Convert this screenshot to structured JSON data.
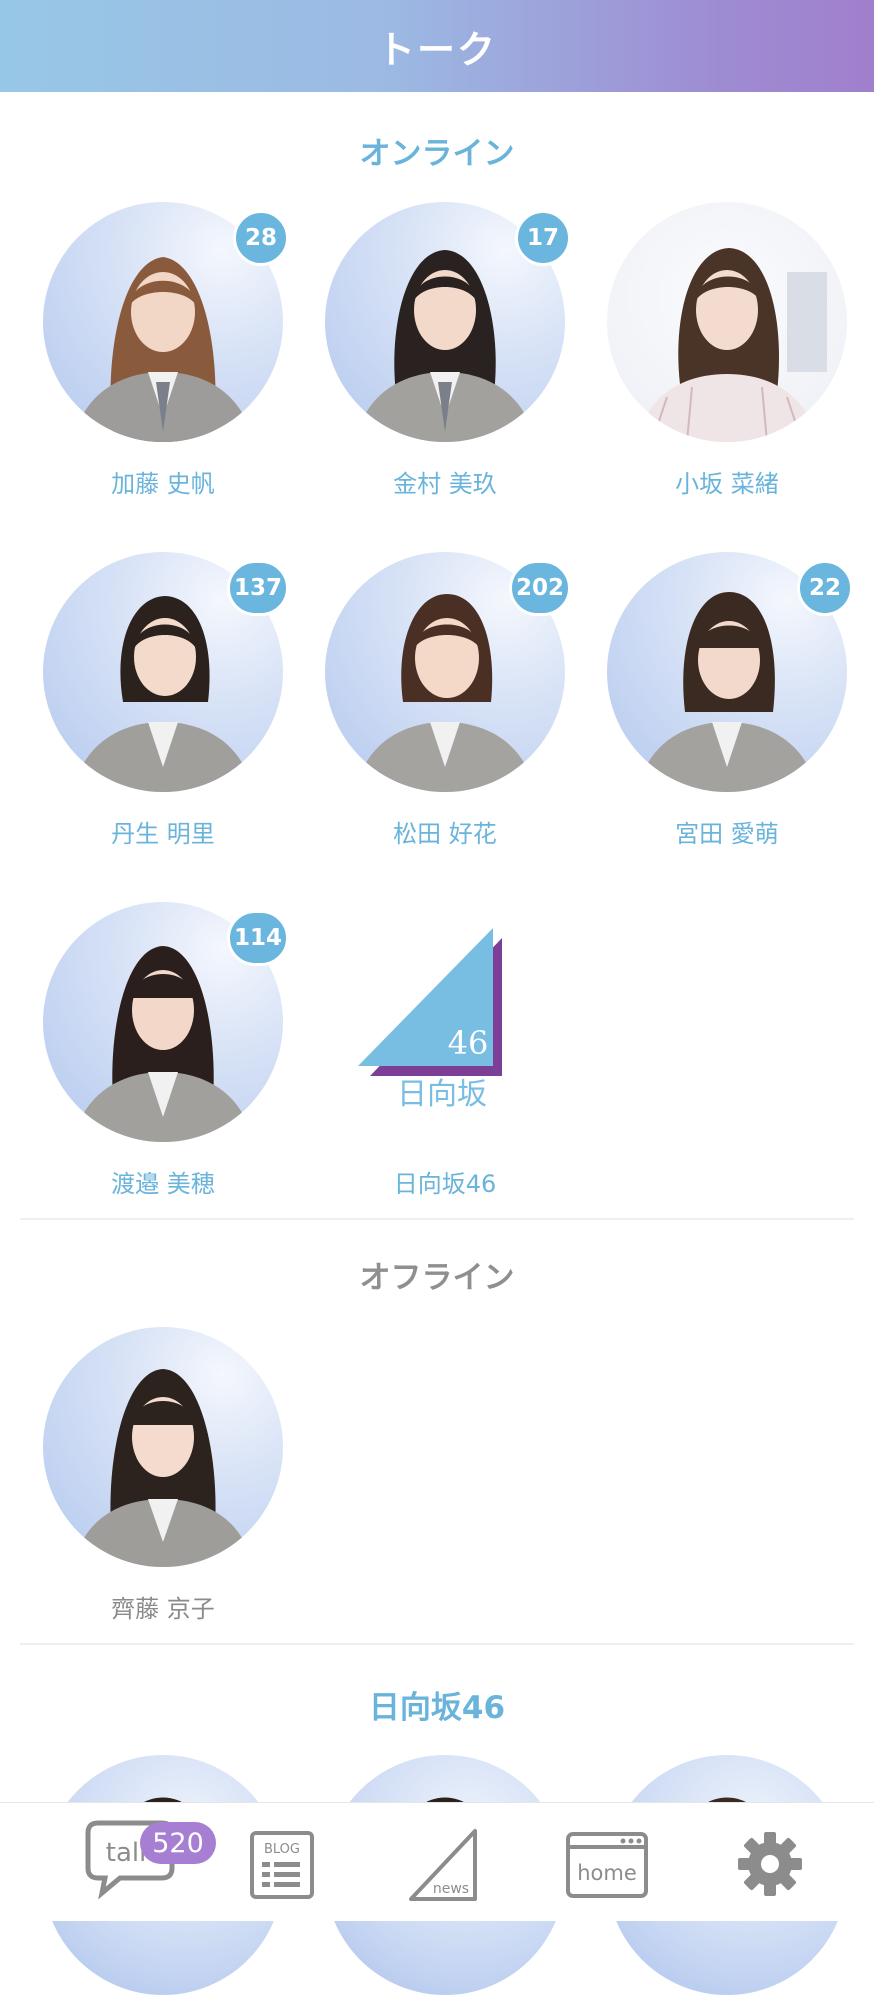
{
  "header": {
    "title": "トーク"
  },
  "sections": {
    "online": "オンライン",
    "offline": "オフライン",
    "group": "日向坂46"
  },
  "online_members": [
    {
      "name": "加藤 史帆",
      "badge": "28"
    },
    {
      "name": "金村 美玖",
      "badge": "17"
    },
    {
      "name": "小坂 菜緒",
      "badge": ""
    },
    {
      "name": "丹生 明里",
      "badge": "137"
    },
    {
      "name": "松田 好花",
      "badge": "202"
    },
    {
      "name": "宮田 愛萌",
      "badge": "22"
    },
    {
      "name": "渡邉 美穂",
      "badge": "114"
    },
    {
      "name": "日向坂46",
      "badge": ""
    }
  ],
  "offline_members": [
    {
      "name": "齊藤 京子"
    }
  ],
  "logo": {
    "number": "46",
    "text": "日向坂"
  },
  "tabbar": {
    "talk_label": "talk",
    "talk_badge": "520",
    "blog_label": "BLOG",
    "news_label": "news",
    "home_label": "home"
  },
  "colors": {
    "accent": "#6ab4dc",
    "badge": "#6ab6de",
    "talk_badge": "#a67fd2",
    "logo_blue": "#78bde2",
    "logo_purple": "#7b3f98",
    "offline_text": "#8f8f8f"
  }
}
